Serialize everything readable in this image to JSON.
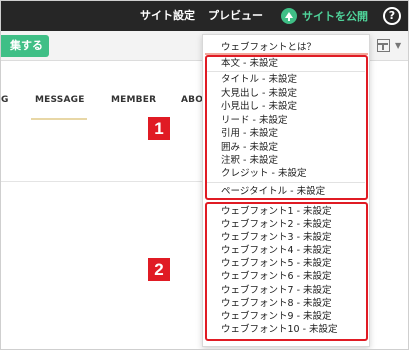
{
  "topbar": {
    "site_settings": "サイト設定",
    "preview": "プレビュー",
    "publish": "サイトを公開",
    "help": "?"
  },
  "toolbar": {
    "edit_label": "集する"
  },
  "sitenav": {
    "items": [
      "G",
      "MESSAGE",
      "MEMBER",
      "ABOU"
    ]
  },
  "dropdown": {
    "header": "ウェブフォントとは？",
    "group1": [
      "本文 - 未設定",
      "タイトル - 未設定",
      "大見出し - 未設定",
      "小見出し - 未設定",
      "リード - 未設定",
      "引用 - 未設定",
      "囲み - 未設定",
      "注釈 - 未設定",
      "クレジット - 未設定",
      "ページタイトル - 未設定"
    ],
    "group2": [
      "ウェブフォント1 - 未設定",
      "ウェブフォント2 - 未設定",
      "ウェブフォント3 - 未設定",
      "ウェブフォント4 - 未設定",
      "ウェブフォント5 - 未設定",
      "ウェブフォント6 - 未設定",
      "ウェブフォント7 - 未設定",
      "ウェブフォント8 - 未設定",
      "ウェブフォント9 - 未設定",
      "ウェブフォント10 - 未設定"
    ]
  },
  "annotations": {
    "badge1": "1",
    "badge2": "2"
  },
  "colors": {
    "accent": "#3fbf86",
    "highlight": "#e01b24",
    "topbar": "#262626"
  }
}
